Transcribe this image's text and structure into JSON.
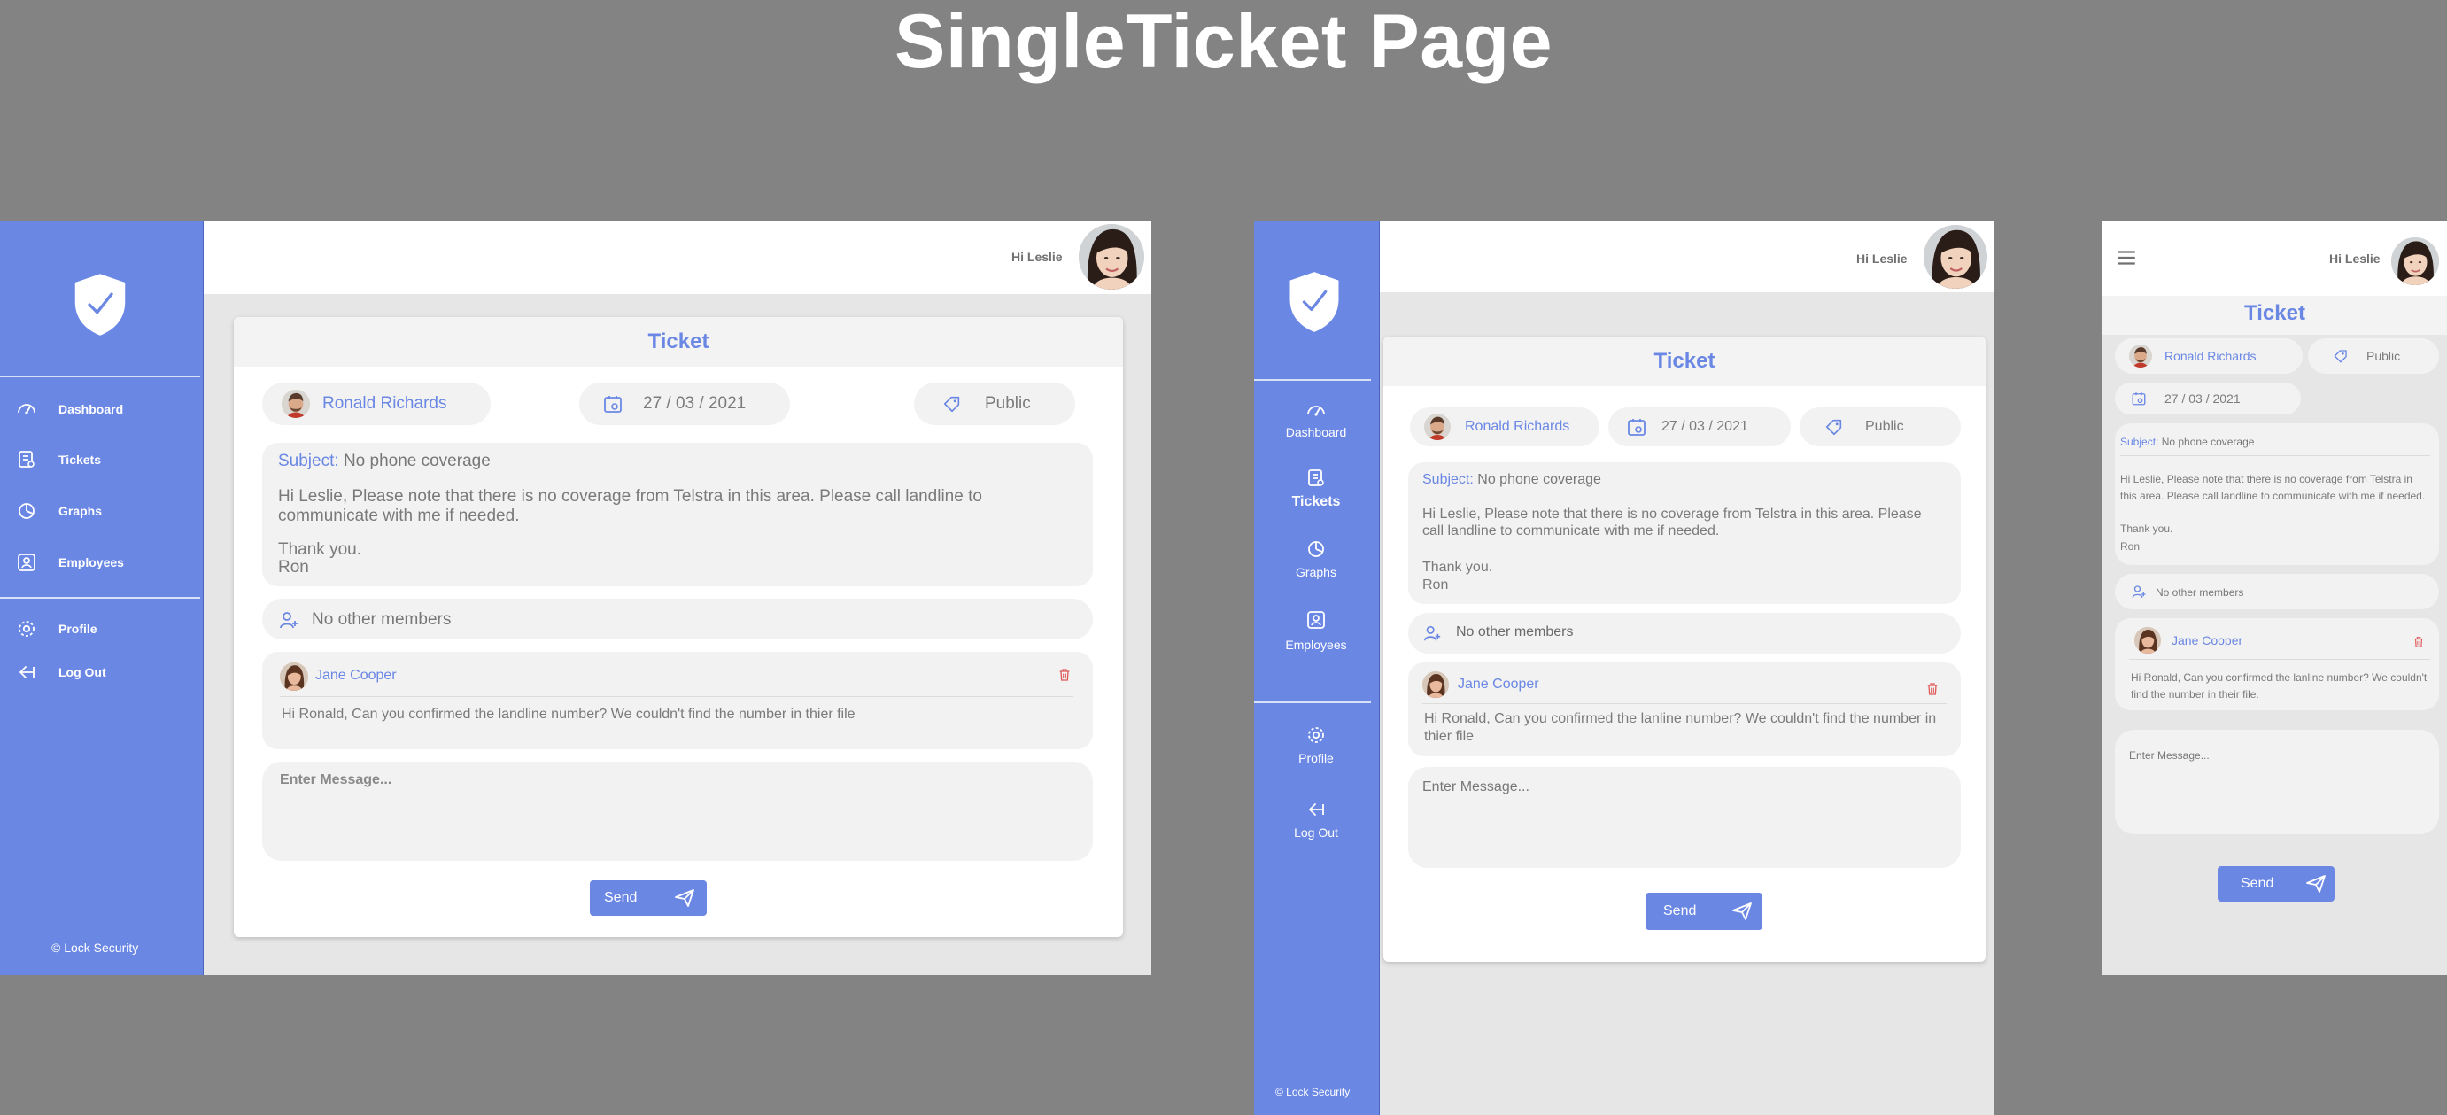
{
  "page": {
    "title": "SingleTicket Page"
  },
  "colors": {
    "brand": "#6a87e4",
    "background": "#838383",
    "panel": "#f2f2f2",
    "danger": "#e05a5a"
  },
  "header": {
    "greeting": "Hi Leslie"
  },
  "nav": {
    "dashboard": "Dashboard",
    "tickets": "Tickets",
    "graphs": "Graphs",
    "employees": "Employees",
    "profile": "Profile",
    "logout": "Log Out"
  },
  "footer": {
    "copyright": "© Lock Security"
  },
  "ticket": {
    "heading": "Ticket",
    "author": "Ronald Richards",
    "date": "27 / 03 / 2021",
    "visibility": "Public",
    "subject_label": "Subject:",
    "subject": "No phone coverage",
    "message_desktop": "Hi Leslie, Please note that there is no coverage from Telstra in this area. Please call landline to communicate with me if needed.",
    "message_tablet": "Hi Leslie, Please note that there is no coverage from Telstra in this area. Please call landline to communicate with me if needed.",
    "message_mobile": "Hi Leslie, Please note that there is no coverage from Telstra in this area. Please call landline to communicate with me if needed.",
    "signoff": "Thank you.",
    "signature": "Ron",
    "members": "No other members"
  },
  "comment": {
    "author": "Jane Cooper",
    "text_desktop": "Hi Ronald, Can you confirmed the landline number? We couldn't find the number in thier file",
    "text_tablet": "Hi Ronald, Can you confirmed the lanline number? We couldn't find the number in thier file",
    "text_mobile": "Hi Ronald, Can you confirmed the lanline number? We couldn't find the number in their file."
  },
  "composer": {
    "placeholder": "Enter Message...",
    "send_label": "Send"
  }
}
